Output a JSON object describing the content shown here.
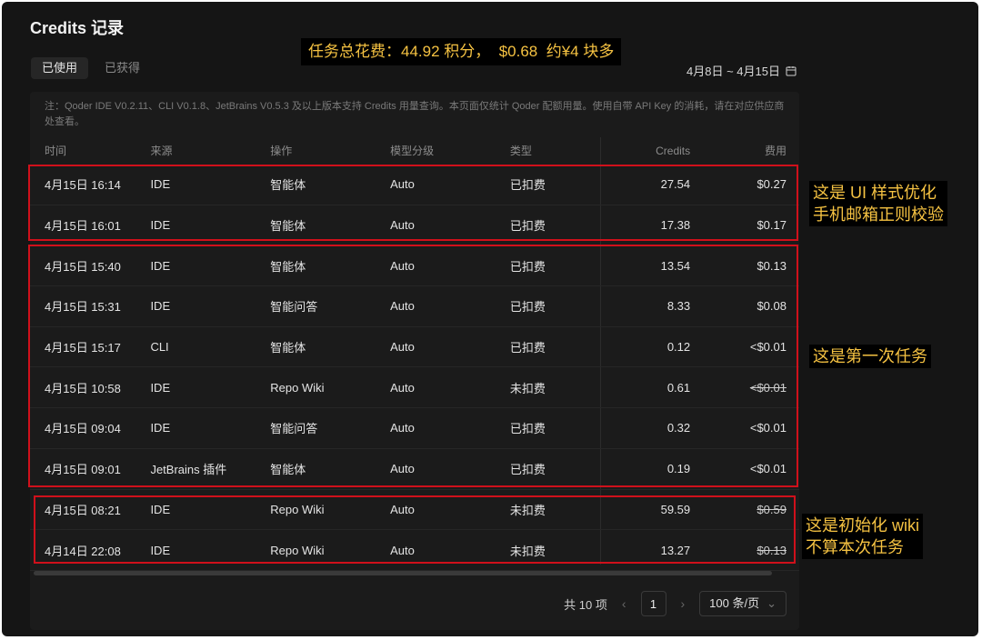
{
  "title": "Credits 记录",
  "summary": "任务总花费：44.92 积分，  $0.68  约¥4 块多",
  "tabs": [
    {
      "label": "已使用",
      "active": true
    },
    {
      "label": "已获得",
      "active": false
    }
  ],
  "date_range": "4月8日 ~ 4月15日",
  "note": "注：Qoder IDE V0.2.11、CLI V0.1.8、JetBrains V0.5.3 及以上版本支持 Credits 用量查询。本页面仅统计 Qoder 配额用量。使用自带 API Key 的消耗，请在对应供应商处查看。",
  "columns": {
    "time": "时间",
    "source": "来源",
    "operation": "操作",
    "model": "模型分级",
    "type": "类型",
    "credits": "Credits",
    "fee": "费用"
  },
  "rows": [
    {
      "time": "4月15日 16:14",
      "source": "IDE",
      "operation": "智能体",
      "model": "Auto",
      "type": "已扣费",
      "credits": "27.54",
      "fee": "$0.27"
    },
    {
      "time": "4月15日 16:01",
      "source": "IDE",
      "operation": "智能体",
      "model": "Auto",
      "type": "已扣费",
      "credits": "17.38",
      "fee": "$0.17"
    },
    {
      "time": "4月15日 15:40",
      "source": "IDE",
      "operation": "智能体",
      "model": "Auto",
      "type": "已扣费",
      "credits": "13.54",
      "fee": "$0.13"
    },
    {
      "time": "4月15日 15:31",
      "source": "IDE",
      "operation": "智能问答",
      "model": "Auto",
      "type": "已扣费",
      "credits": "8.33",
      "fee": "$0.08"
    },
    {
      "time": "4月15日 15:17",
      "source": "CLI",
      "operation": "智能体",
      "model": "Auto",
      "type": "已扣费",
      "credits": "0.12",
      "fee": "<$0.01"
    },
    {
      "time": "4月15日 10:58",
      "source": "IDE",
      "operation": "Repo Wiki",
      "model": "Auto",
      "type": "未扣费",
      "credits": "0.61",
      "fee": "<$0.01"
    },
    {
      "time": "4月15日 09:04",
      "source": "IDE",
      "operation": "智能问答",
      "model": "Auto",
      "type": "已扣费",
      "credits": "0.32",
      "fee": "<$0.01"
    },
    {
      "time": "4月15日 09:01",
      "source": "JetBrains 插件",
      "operation": "智能体",
      "model": "Auto",
      "type": "已扣费",
      "credits": "0.19",
      "fee": "<$0.01"
    },
    {
      "time": "4月15日 08:21",
      "source": "IDE",
      "operation": "Repo Wiki",
      "model": "Auto",
      "type": "未扣费",
      "credits": "59.59",
      "fee": "$0.59"
    },
    {
      "time": "4月14日 22:08",
      "source": "IDE",
      "operation": "Repo Wiki",
      "model": "Auto",
      "type": "未扣费",
      "credits": "13.27",
      "fee": "$0.13"
    }
  ],
  "pagination": {
    "total": "共 10 项",
    "prev": "‹",
    "page": "1",
    "next": "›",
    "page_size": "100 条/页",
    "dropdown": "⌄"
  },
  "annotations": {
    "a1": "这是 UI 样式优化\n手机邮箱正则校验",
    "a2": "这是第一次任务",
    "a3": "这是初始化 wiki\n不算本次任务"
  },
  "colors": {
    "highlight": "#d0101b",
    "annotation_text": "#f5c242",
    "background": "#151515"
  },
  "icons": {
    "date": "calendar-icon"
  }
}
